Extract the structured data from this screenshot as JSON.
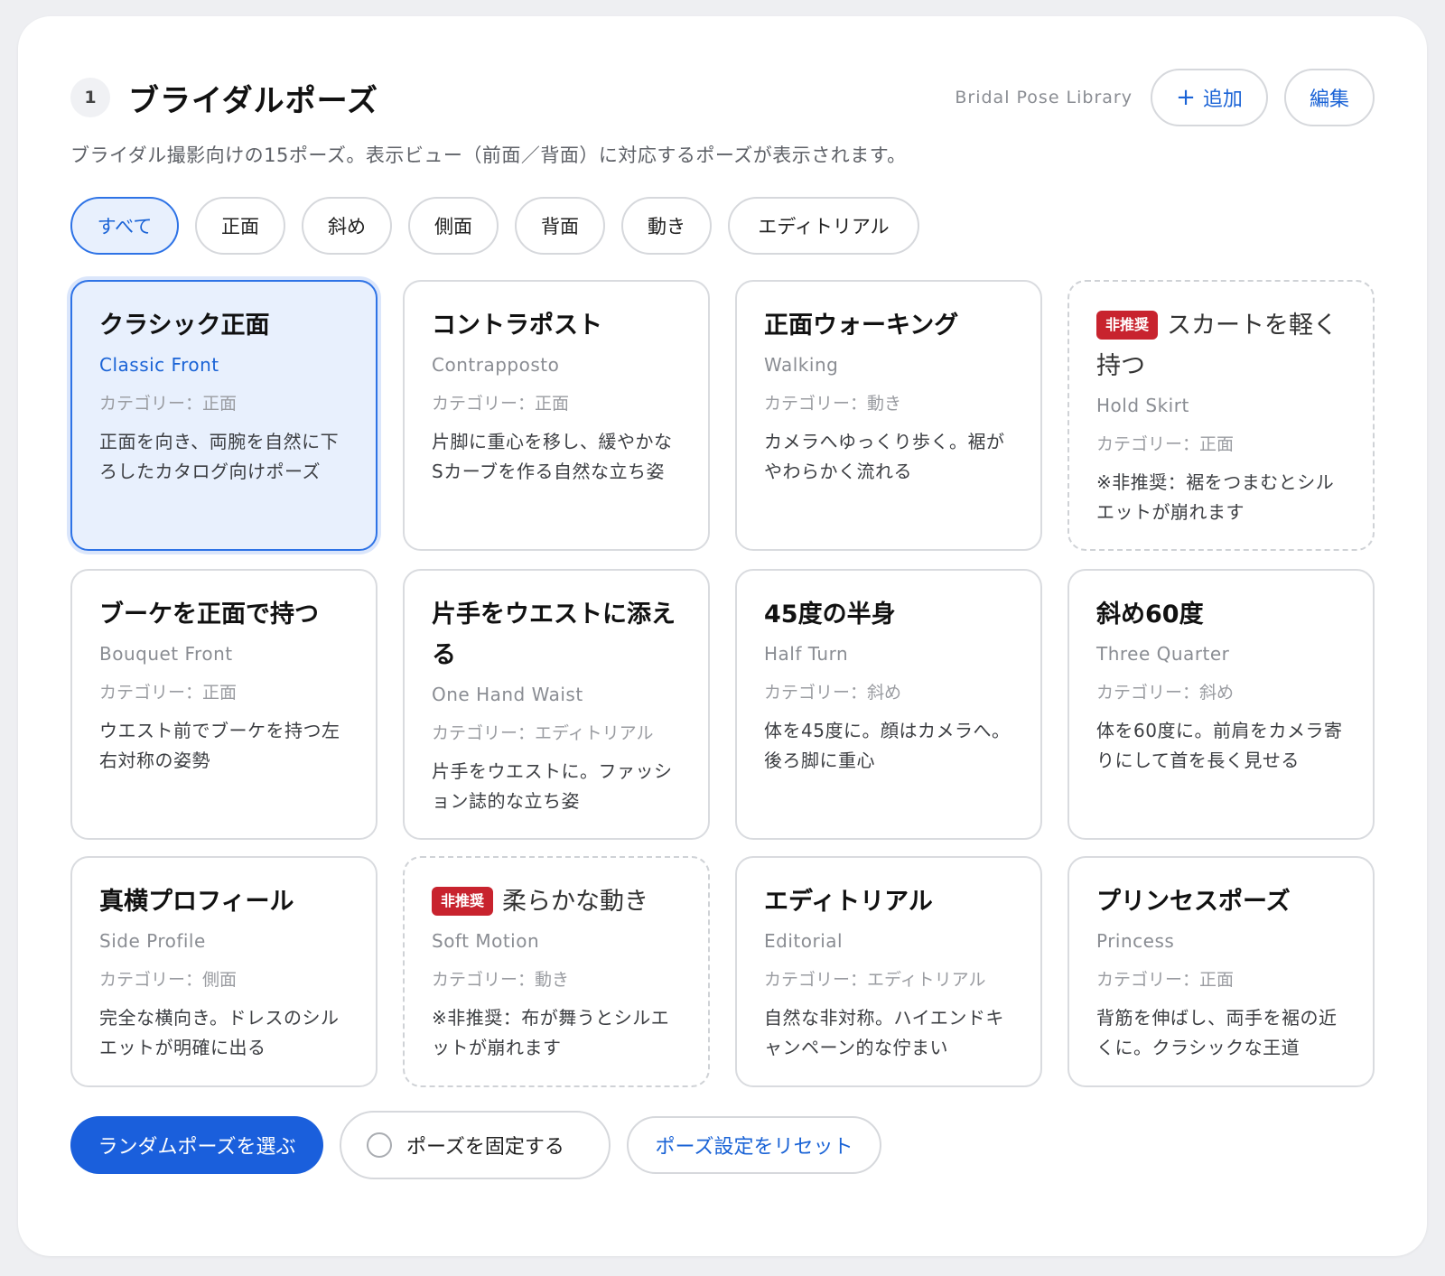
{
  "header": {
    "step_number": "1",
    "title": "ブライダルポーズ",
    "library_label": "Bridal Pose Library",
    "add_label": "追加",
    "edit_label": "編集"
  },
  "description": "ブライダル撮影向けの15ポーズ。表示ビュー（前面／背面）に対応するポーズが表示されます。",
  "filters": [
    {
      "label": "すべて",
      "active": true
    },
    {
      "label": "正面"
    },
    {
      "label": "斜め"
    },
    {
      "label": "側面"
    },
    {
      "label": "背面"
    },
    {
      "label": "動き"
    },
    {
      "label": "エディトリアル"
    }
  ],
  "not_recommended_label": "非推奨",
  "poses": [
    {
      "title": "クラシック正面",
      "en": "Classic Front",
      "category": "カテゴリー：正面",
      "desc": "正面を向き、両腕を自然に下ろしたカタログ向けポーズ",
      "selected": true
    },
    {
      "title": "コントラポスト",
      "en": "Contrapposto",
      "category": "カテゴリー：正面",
      "desc": "片脚に重心を移し、緩やかなSカーブを作る自然な立ち姿"
    },
    {
      "title": "正面ウォーキング",
      "en": "Walking",
      "category": "カテゴリー：動き",
      "desc": "カメラへゆっくり歩く。裾がやわらかく流れる"
    },
    {
      "title": "スカートを軽く持つ",
      "en": "Hold Skirt",
      "category": "カテゴリー：正面",
      "desc": "※非推奨：裾をつまむとシルエットが崩れます",
      "not_recommended": true
    },
    {
      "title": "ブーケを正面で持つ",
      "en": "Bouquet Front",
      "category": "カテゴリー：正面",
      "desc": "ウエスト前でブーケを持つ左右対称の姿勢"
    },
    {
      "title": "片手をウエストに添える",
      "en": "One Hand Waist",
      "category": "カテゴリー：エディトリアル",
      "desc": "片手をウエストに。ファッション誌的な立ち姿"
    },
    {
      "title": "45度の半身",
      "en": "Half Turn",
      "category": "カテゴリー：斜め",
      "desc": "体を45度に。顔はカメラへ。後ろ脚に重心"
    },
    {
      "title": "斜め60度",
      "en": "Three Quarter",
      "category": "カテゴリー：斜め",
      "desc": "体を60度に。前肩をカメラ寄りにして首を長く見せる"
    },
    {
      "title": "真横プロフィール",
      "en": "Side Profile",
      "category": "カテゴリー：側面",
      "desc": "完全な横向き。ドレスのシルエットが明確に出る"
    },
    {
      "title": "柔らかな動き",
      "en": "Soft Motion",
      "category": "カテゴリー：動き",
      "desc": "※非推奨：布が舞うとシルエットが崩れます",
      "not_recommended": true
    },
    {
      "title": "エディトリアル",
      "en": "Editorial",
      "category": "カテゴリー：エディトリアル",
      "desc": "自然な非対称。ハイエンドキャンペーン的な佇まい"
    },
    {
      "title": "プリンセスポーズ",
      "en": "Princess",
      "category": "カテゴリー：正面",
      "desc": "背筋を伸ばし、両手を裾の近くに。クラシックな王道"
    }
  ],
  "actions": {
    "random_label": "ランダムポーズを選ぶ",
    "lock_label": "ポーズを固定する",
    "reset_label": "ポーズ設定をリセット"
  },
  "colors": {
    "accent": "#1a63d6",
    "primary_button": "#1a5fdc",
    "selected_bg": "#e8f0fd",
    "not_recommended": "#c8232e"
  }
}
